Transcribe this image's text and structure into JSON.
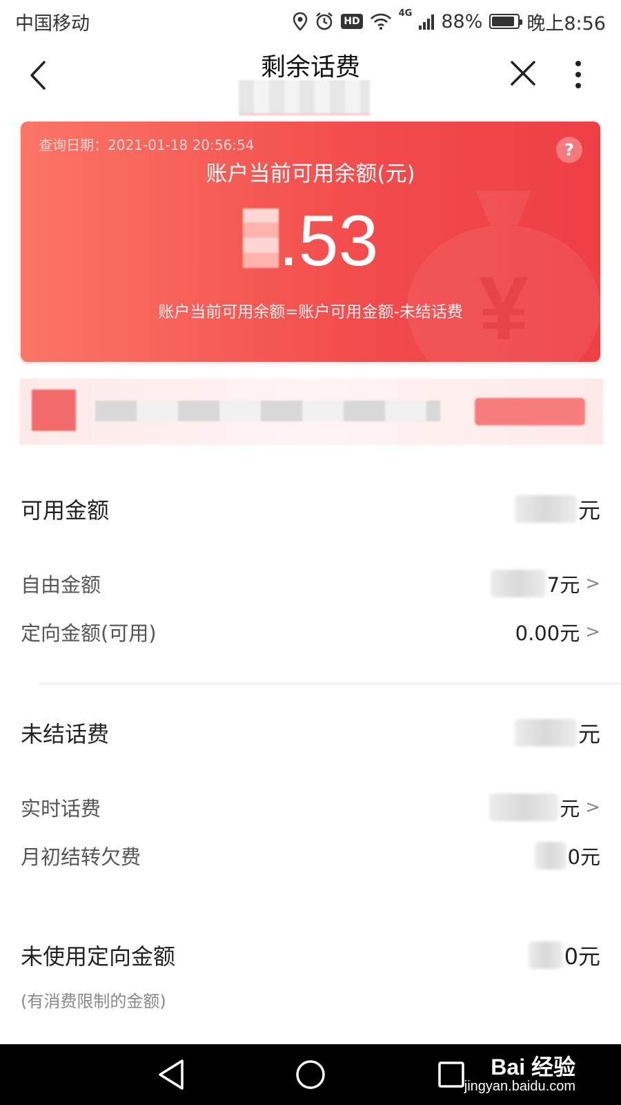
{
  "status_bar": {
    "carrier": "中国移动",
    "network": "4G",
    "battery": "88%",
    "battery_level": 0.88,
    "time": "晚上8:56",
    "icons": [
      "location-icon",
      "alarm-icon",
      "hd-icon",
      "wifi-icon",
      "signal-icon",
      "battery-icon"
    ]
  },
  "nav": {
    "title": "剩余话费",
    "hd_badge": "HD"
  },
  "balance_card": {
    "query_date": "查询日期：2021-01-18 20:56:54",
    "label": "账户当前可用余额(元)",
    "amount_visible": ".53",
    "formula": "账户当前可用余额=账户可用金额-未结话费",
    "help": "?",
    "deco_symbol": "¥"
  },
  "rows": {
    "available": {
      "label": "可用金额",
      "value": "元"
    },
    "free_amount": {
      "label": "自由金额",
      "value": "7元"
    },
    "directed_available": {
      "label": "定向金额(可用)",
      "value": "0.00元"
    },
    "unsettled": {
      "label": "未结话费",
      "value": "元"
    },
    "realtime": {
      "label": "实时话费",
      "value": "元"
    },
    "month_start_arrears": {
      "label": "月初结转欠费",
      "value": "0元"
    },
    "unused_directed": {
      "label": "未使用定向金额",
      "value": "0元",
      "note": "(有消费限制的金额)"
    }
  },
  "system_nav": {
    "watermark_logo": "Bai 经验",
    "watermark_url": "jingyan.baidu.com"
  },
  "colors": {
    "card_start": "#fb7565",
    "card_end": "#ee3f45",
    "text_main": "#222222",
    "text_secondary": "#888888"
  }
}
